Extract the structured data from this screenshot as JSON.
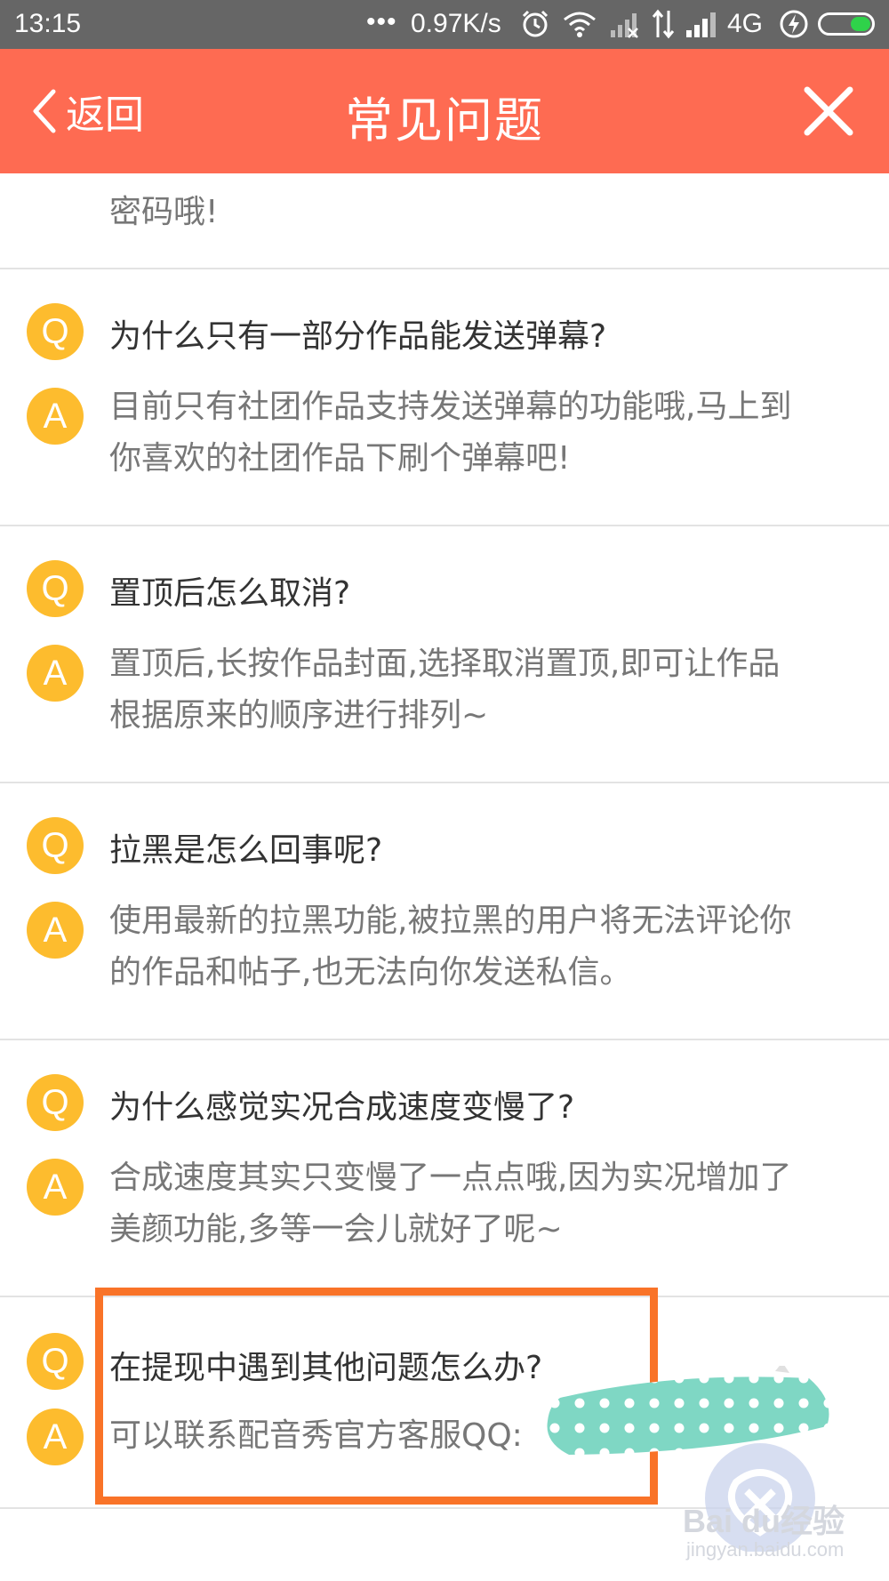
{
  "status_bar": {
    "time": "13:15",
    "dots": "•••",
    "network_speed": "0.97K/s",
    "network_type": "4G",
    "icons": [
      "alarm-icon",
      "wifi-icon",
      "signal-x-icon",
      "data-arrows-icon",
      "signal-icon",
      "charging-icon",
      "battery-icon"
    ],
    "battery_color": "#2fd24a"
  },
  "nav": {
    "back_label": "返回",
    "title": "常见问题",
    "background": "#fe6b52"
  },
  "faq": {
    "partial_answer": "密码哦!",
    "q_badge": "Q",
    "a_badge": "A",
    "badge_color": "#fdbc2e",
    "items": [
      {
        "question": "为什么只有一部分作品能发送弹幕?",
        "answer": "目前只有社团作品支持发送弹幕的功能哦,马上到你喜欢的社团作品下刷个弹幕吧!"
      },
      {
        "question": "置顶后怎么取消?",
        "answer": "置顶后,长按作品封面,选择取消置顶,即可让作品根据原来的顺序进行排列~"
      },
      {
        "question": "拉黑是怎么回事呢?",
        "answer": "使用最新的拉黑功能,被拉黑的用户将无法评论你的作品和帖子,也无法向你发送私信。"
      },
      {
        "question": "为什么感觉实况合成速度变慢了?",
        "answer": "合成速度其实只变慢了一点点哦,因为实况增加了美颜功能,多等一会儿就好了呢~"
      },
      {
        "question": "在提现中遇到其他问题怎么办?",
        "answer": "可以联系配音秀官方客服QQ:"
      }
    ]
  },
  "overlay": {
    "highlight_color": "#f97328",
    "watermark_text": "Bai du经验",
    "watermark_url": "jingyan.baidu.com"
  }
}
